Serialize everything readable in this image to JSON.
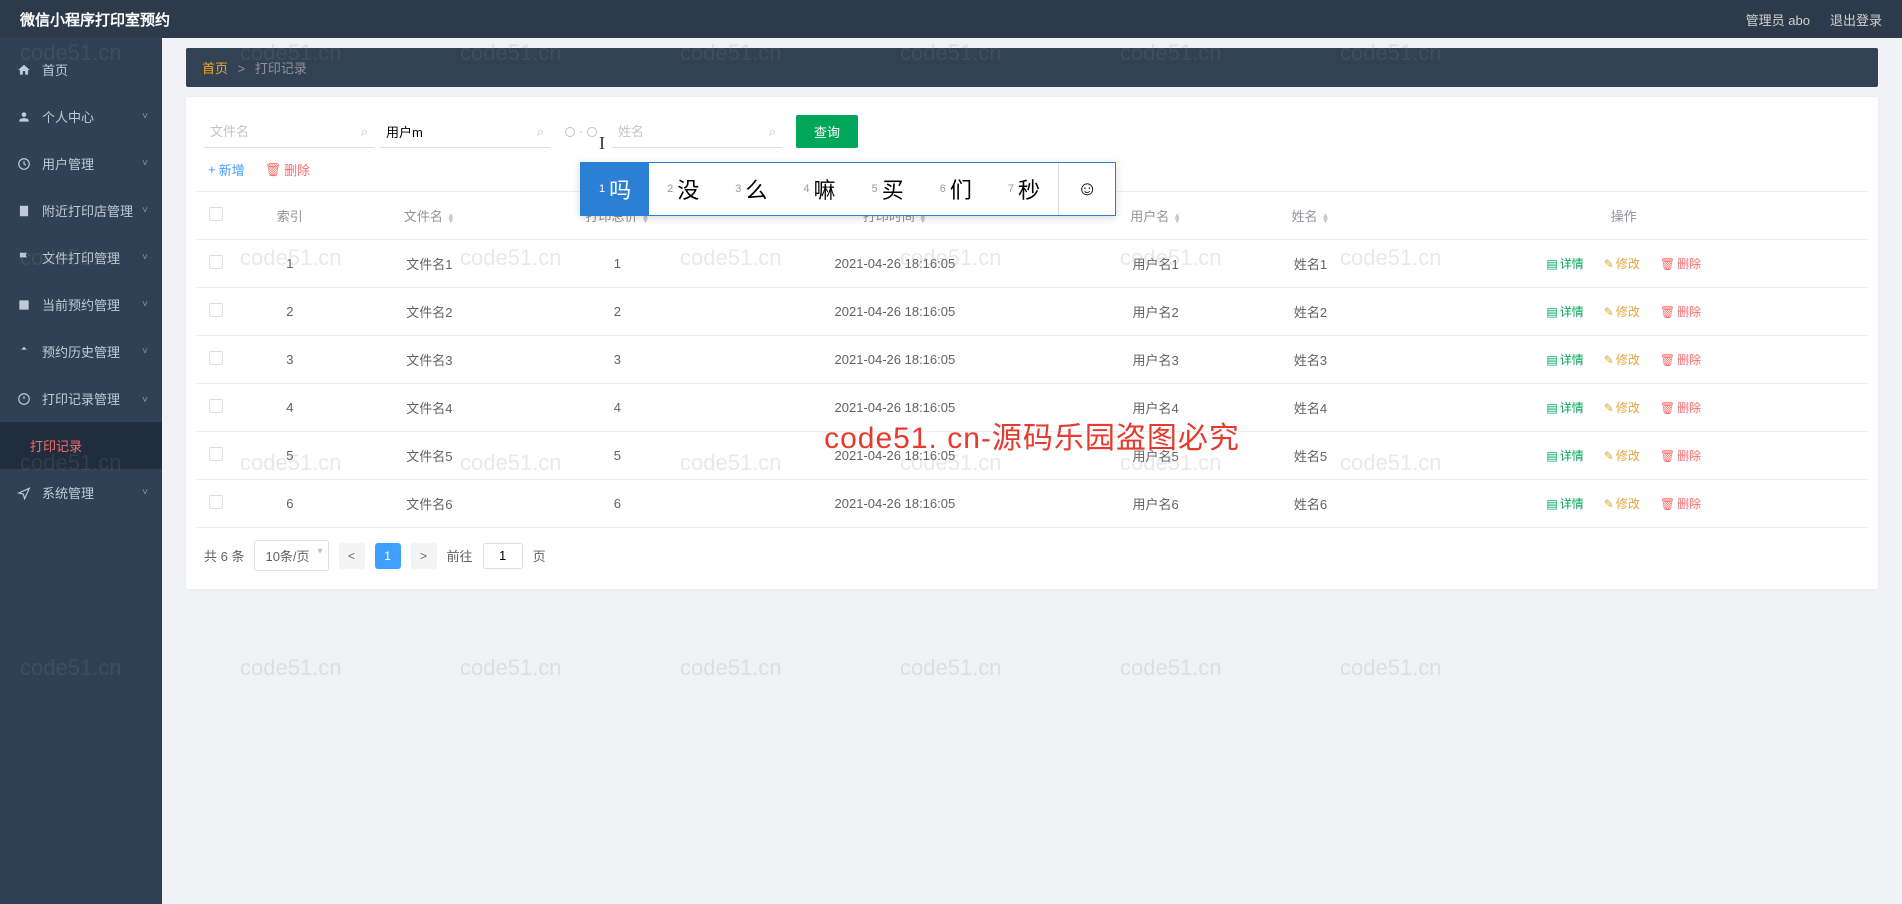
{
  "header": {
    "title": "微信小程序打印室预约",
    "admin": "管理员 abo",
    "logout": "退出登录"
  },
  "sidebar": {
    "items": [
      {
        "label": "首页",
        "icon": "home",
        "hasArrow": false
      },
      {
        "label": "个人中心",
        "icon": "user",
        "hasArrow": true
      },
      {
        "label": "用户管理",
        "icon": "clock",
        "hasArrow": true
      },
      {
        "label": "附近打印店管理",
        "icon": "building",
        "hasArrow": true
      },
      {
        "label": "文件打印管理",
        "icon": "flag",
        "hasArrow": true
      },
      {
        "label": "当前预约管理",
        "icon": "list",
        "hasArrow": true
      },
      {
        "label": "预约历史管理",
        "icon": "upload",
        "hasArrow": true
      },
      {
        "label": "打印记录管理",
        "icon": "power",
        "hasArrow": true,
        "expanded": true
      },
      {
        "label": "打印记录",
        "sub": true
      },
      {
        "label": "系统管理",
        "icon": "nav",
        "hasArrow": true
      }
    ]
  },
  "breadcrumb": {
    "home": "首页",
    "current": "打印记录"
  },
  "search": {
    "filename_ph": "文件名",
    "username_val": "用户m",
    "name_ph": "姓名",
    "query_btn": "查询"
  },
  "actions": {
    "add": "新增",
    "delete": "删除"
  },
  "table": {
    "headers": {
      "index": "索引",
      "filename": "文件名",
      "total": "打印总价",
      "time": "打印时间",
      "username": "用户名",
      "name": "姓名",
      "ops": "操作"
    },
    "op_labels": {
      "detail": "详情",
      "edit": "修改",
      "delete": "删除"
    },
    "rows": [
      {
        "idx": "1",
        "filename": "文件名1",
        "total": "1",
        "time": "2021-04-26 18:16:05",
        "username": "用户名1",
        "name": "姓名1"
      },
      {
        "idx": "2",
        "filename": "文件名2",
        "total": "2",
        "time": "2021-04-26 18:16:05",
        "username": "用户名2",
        "name": "姓名2"
      },
      {
        "idx": "3",
        "filename": "文件名3",
        "total": "3",
        "time": "2021-04-26 18:16:05",
        "username": "用户名3",
        "name": "姓名3"
      },
      {
        "idx": "4",
        "filename": "文件名4",
        "total": "4",
        "time": "2021-04-26 18:16:05",
        "username": "用户名4",
        "name": "姓名4"
      },
      {
        "idx": "5",
        "filename": "文件名5",
        "total": "5",
        "time": "2021-04-26 18:16:05",
        "username": "用户名5",
        "name": "姓名5"
      },
      {
        "idx": "6",
        "filename": "文件名6",
        "total": "6",
        "time": "2021-04-26 18:16:05",
        "username": "用户名6",
        "name": "姓名6"
      }
    ]
  },
  "pagination": {
    "total_text": "共 6 条",
    "page_size": "10条/页",
    "current": "1",
    "goto_label": "前往",
    "goto_value": "1",
    "goto_suffix": "页"
  },
  "ime": {
    "candidates": [
      {
        "n": "1",
        "ch": "吗"
      },
      {
        "n": "2",
        "ch": "没"
      },
      {
        "n": "3",
        "ch": "么"
      },
      {
        "n": "4",
        "ch": "嘛"
      },
      {
        "n": "5",
        "ch": "买"
      },
      {
        "n": "6",
        "ch": "们"
      },
      {
        "n": "7",
        "ch": "秒"
      }
    ]
  },
  "watermark": {
    "main": "code51. cn-源码乐园盗图必究",
    "bg": "code51.cn"
  }
}
